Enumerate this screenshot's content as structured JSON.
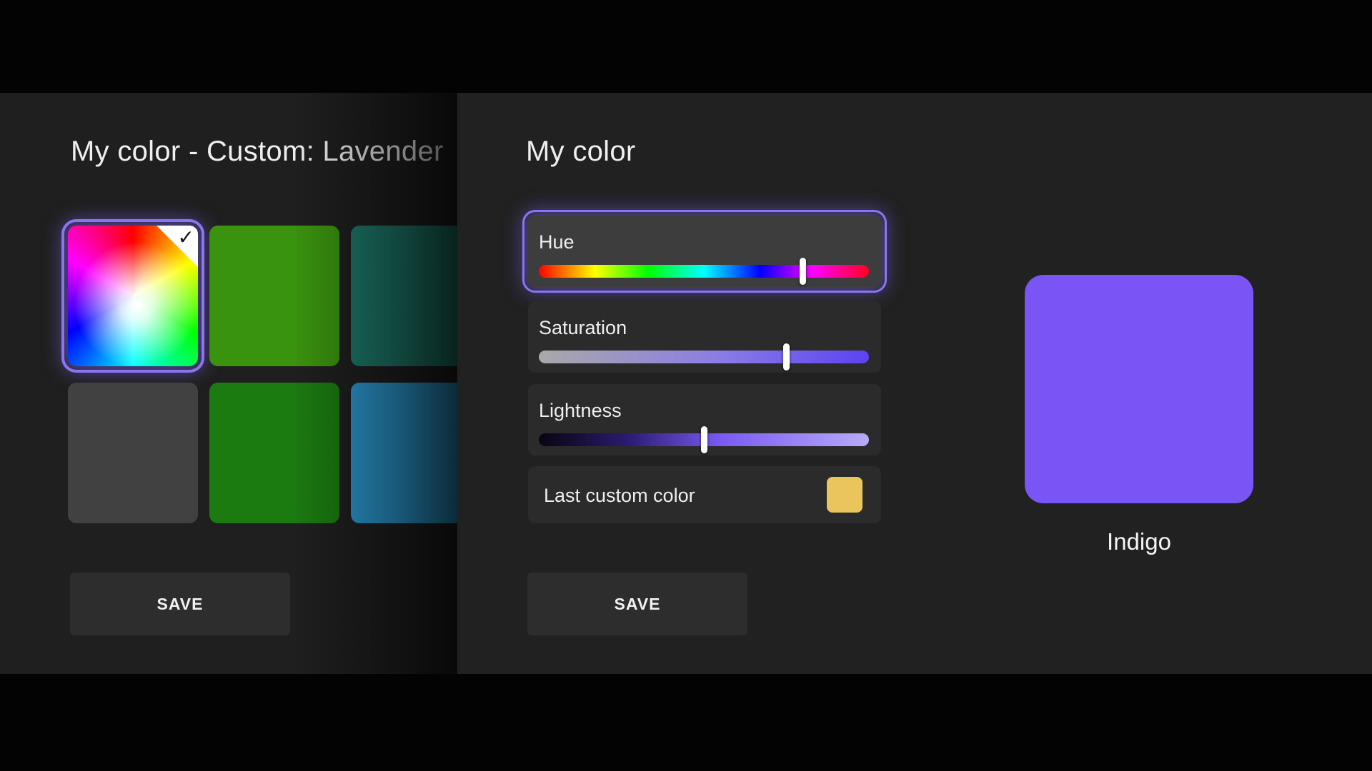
{
  "colors": {
    "accent_focus_ring": "#8b74f2",
    "left_panel_bg": "#1f1f1f",
    "dialog_bg": "#212121",
    "tile_bg": "#2b2b2b",
    "tile_focused_bg": "#3d3d3d",
    "button_bg": "#2d2d2d"
  },
  "left_panel": {
    "title": "My color - Custom: Lavender",
    "save_label": "SAVE",
    "swatches": [
      {
        "name": "custom-spectrum",
        "type": "spectrum",
        "selected": true
      },
      {
        "name": "green",
        "color": "#3a930f"
      },
      {
        "name": "teal",
        "color": "#1d7a6a"
      },
      {
        "name": "dark-gray",
        "color": "#414141"
      },
      {
        "name": "dark-green",
        "color": "#1b7a10"
      },
      {
        "name": "blue",
        "color": "#2b98cf"
      }
    ]
  },
  "dialog": {
    "title": "My color",
    "save_label": "SAVE",
    "sliders": [
      {
        "label": "Hue",
        "value_pct": 80,
        "focused": true
      },
      {
        "label": "Saturation",
        "value_pct": 75,
        "focused": false
      },
      {
        "label": "Lightness",
        "value_pct": 50,
        "focused": false
      }
    ],
    "last_custom": {
      "label": "Last custom color",
      "color": "#eac55c"
    }
  },
  "preview": {
    "name": "Indigo",
    "color": "#7b54f6"
  },
  "icons": {
    "check": "✓"
  }
}
